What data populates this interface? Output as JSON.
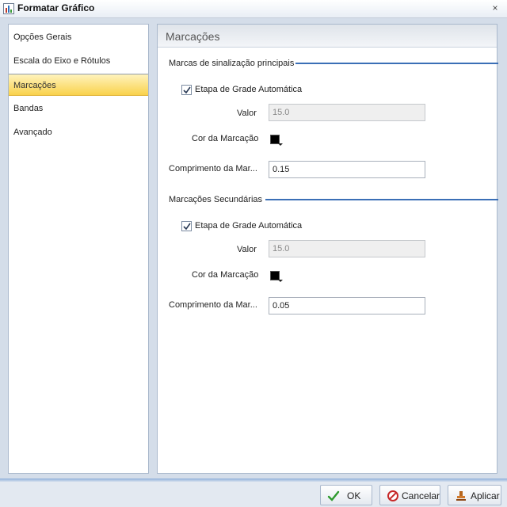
{
  "window": {
    "title": "Formatar Gráfico",
    "close_glyph": "×"
  },
  "sidebar": {
    "items": [
      {
        "label": "Opções Gerais",
        "active": false
      },
      {
        "label": "Escala do Eixo e Rótulos",
        "active": false
      },
      {
        "label": "Marcações",
        "active": true
      },
      {
        "label": "Bandas",
        "active": false
      },
      {
        "label": "Avançado",
        "active": false
      }
    ]
  },
  "content": {
    "title": "Marcações",
    "major": {
      "label": "Marcas de sinalização principais",
      "auto_step_label": "Etapa de Grade Automática",
      "auto_step_checked": true,
      "value_label": "Valor",
      "value": "15.0",
      "color_label": "Cor da Marcação",
      "color": "#000000",
      "length_label": "Comprimento da Mar...",
      "length": "0.15"
    },
    "minor": {
      "label": "Marcações Secundárias",
      "auto_step_label": "Etapa de Grade Automática",
      "auto_step_checked": true,
      "value_label": "Valor",
      "value": "15.0",
      "color_label": "Cor da Marcação",
      "color": "#000000",
      "length_label": "Comprimento da Mar...",
      "length": "0.05"
    }
  },
  "footer": {
    "ok_label": "OK",
    "cancel_label": "Cancelar",
    "apply_label": "Aplicar"
  },
  "icons": {
    "app": "chart-icon",
    "ok": "checkmark-icon",
    "cancel": "cancel-icon",
    "apply": "apply-stamp-icon"
  }
}
